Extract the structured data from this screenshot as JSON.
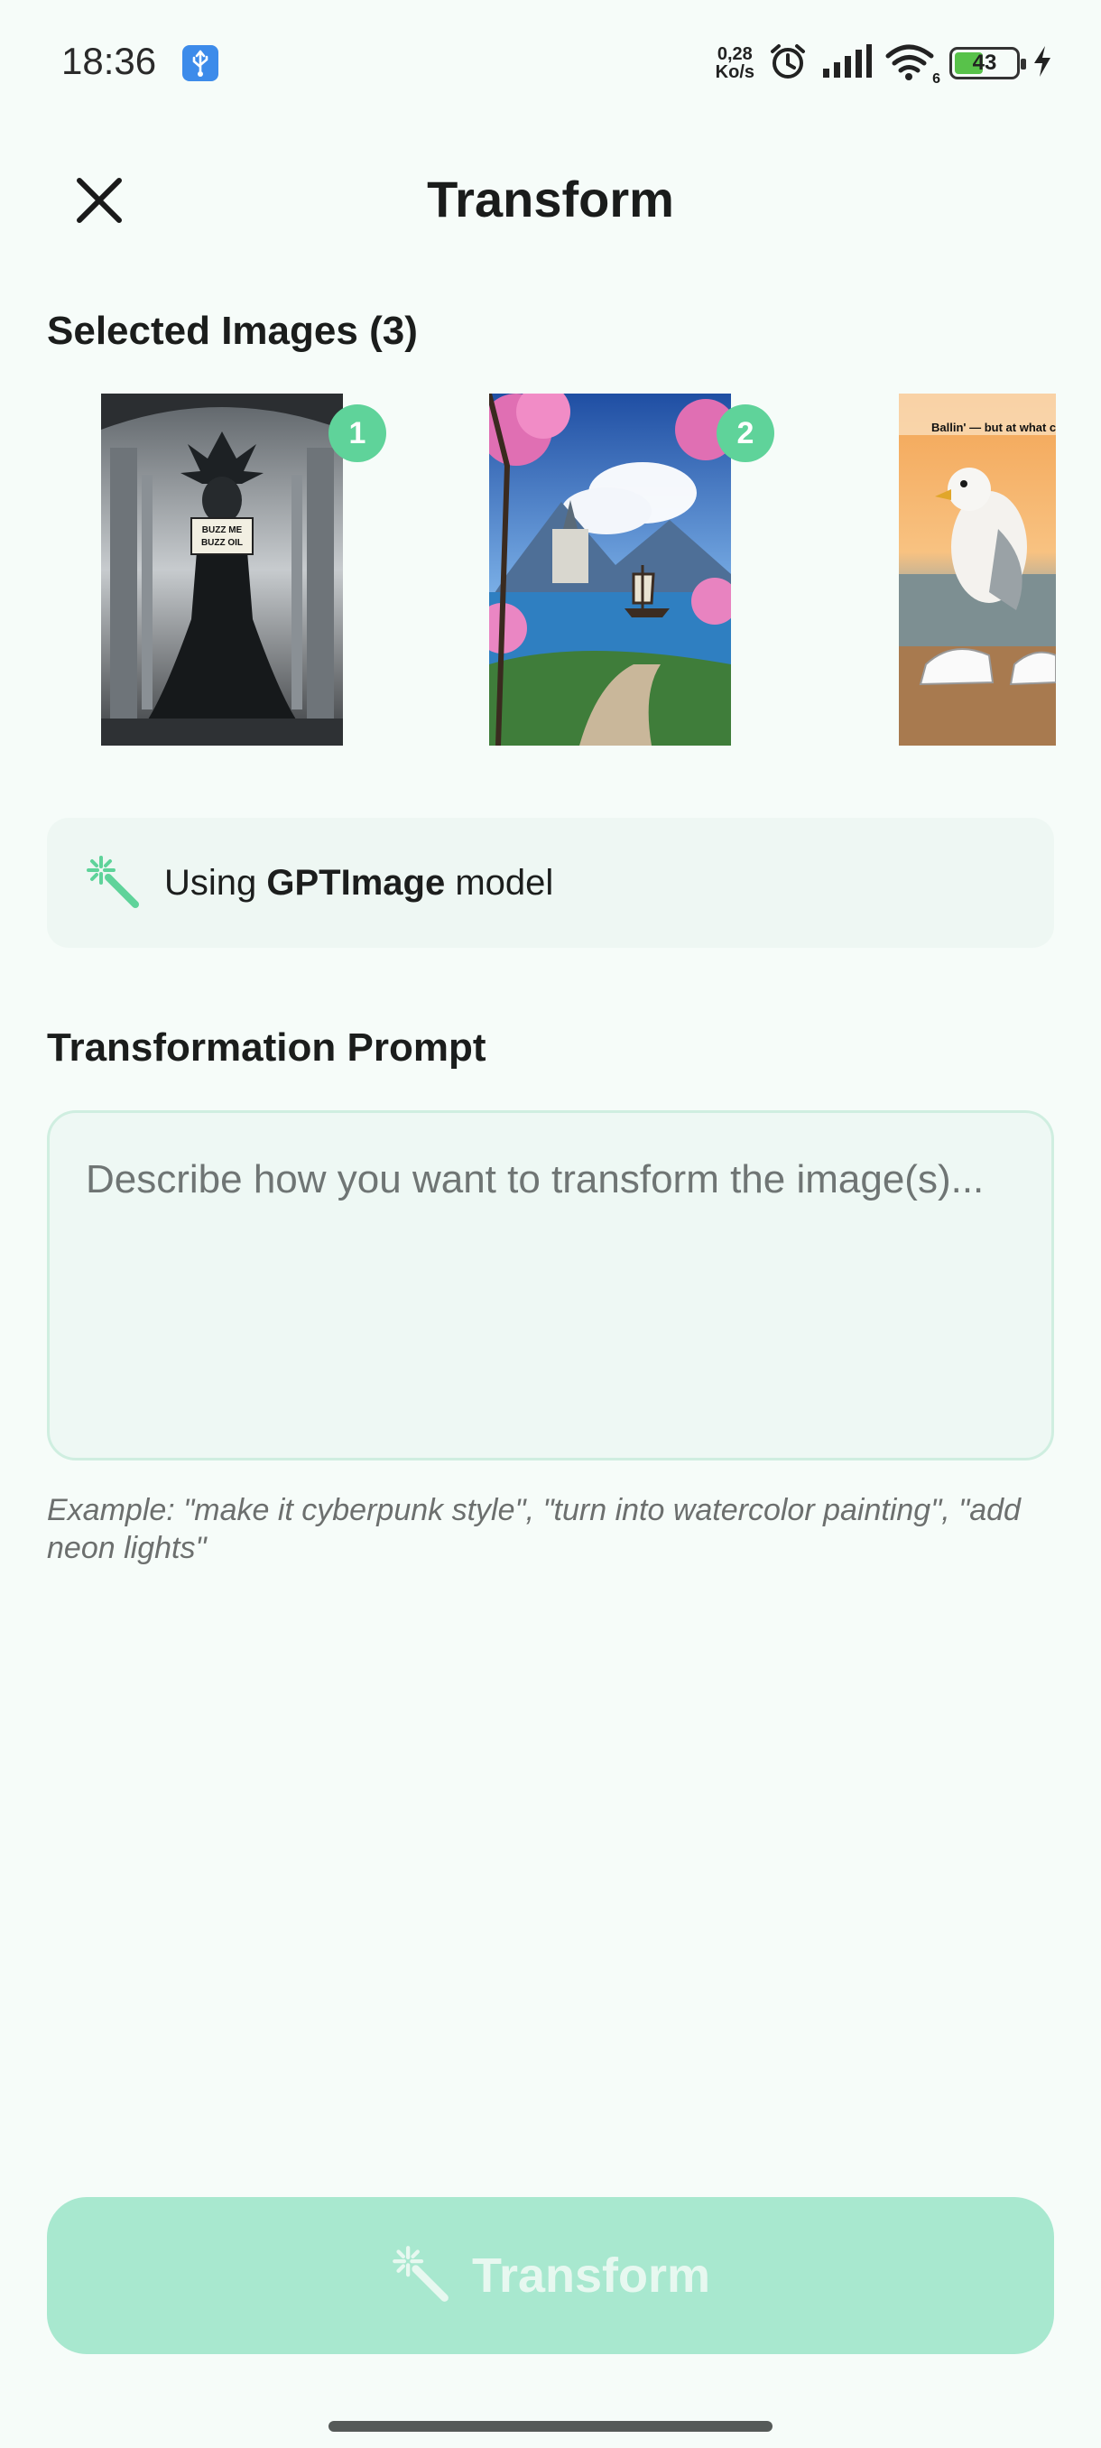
{
  "status_bar": {
    "time": "18:36",
    "net_speed_value": "0,28",
    "net_speed_unit": "Ko/s",
    "battery_level": "43",
    "wifi_label": "6"
  },
  "header": {
    "title": "Transform",
    "close_icon": "close-icon"
  },
  "selected_images": {
    "heading": "Selected Images (3)",
    "items": [
      {
        "badge": "1",
        "caption": "BUZZ ME BUZZ OIL"
      },
      {
        "badge": "2"
      },
      {
        "caption": "Ballin' — but at what cost"
      }
    ]
  },
  "model": {
    "prefix": "Using ",
    "name": "GPTImage",
    "suffix": " model",
    "icon": "magic-wand-icon"
  },
  "prompt": {
    "heading": "Transformation Prompt",
    "value": "",
    "placeholder": "Describe how you want to transform the image(s)...",
    "example": "Example: \"make it cyberpunk style\", \"turn into watercolor painting\", \"add neon lights\""
  },
  "action": {
    "label": "Transform",
    "icon": "magic-wand-icon",
    "enabled": false
  },
  "colors": {
    "accent": "#5fd39a",
    "button_disabled": "#a8e8cf",
    "background": "#f6fcf9",
    "card": "#eef7f3"
  }
}
